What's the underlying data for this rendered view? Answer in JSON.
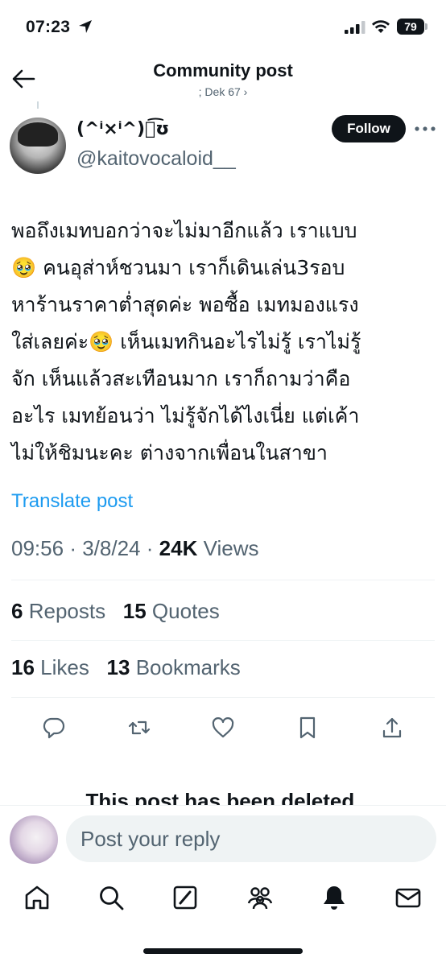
{
  "status_bar": {
    "time": "07:23",
    "battery": "79"
  },
  "header": {
    "title": "Community post",
    "subtitle": "; Dek 67 ›"
  },
  "author": {
    "display_name": "(^ⁱ×ⁱ^)ノ͡ʊ",
    "handle": "@kaitovocaloid__",
    "follow_label": "Follow"
  },
  "post": {
    "lines": [
      "พอถึงเมทบอกว่าจะไม่มาอีกแล้ว เราแบบ",
      "🥹 คนอุส่าห์ชวนมา เราก็เดินเล่น3รอบ",
      "หาร้านราคาต่ำสุดค่ะ พอซื้อ เมทมองแรง",
      "ใส่เลยค่ะ🥹 เห็นเมทกินอะไรไม่รู้ เราไม่รู้",
      "จัก เห็นแล้วสะเทือนมาก เราก็ถามว่าคือ",
      "อะไร เมทย้อนว่า ไม่รู้จักได้ไงเนี่ย แต่เค้า",
      "ไม่ให้ชิมนะคะ ต่างจากเพื่อนในสาขา"
    ],
    "translate_label": "Translate post",
    "time": "09:56",
    "date": "3/8/24",
    "views_count": "24K",
    "views_label": "Views",
    "separator": "·"
  },
  "stats": {
    "reposts_count": "6",
    "reposts_label": "Reposts",
    "quotes_count": "15",
    "quotes_label": "Quotes",
    "likes_count": "16",
    "likes_label": "Likes",
    "bookmarks_count": "13",
    "bookmarks_label": "Bookmarks"
  },
  "deleted_notice": "This post has been deleted.",
  "reply": {
    "placeholder": "Post your reply"
  },
  "icons": {
    "status": [
      "location-arrow-icon",
      "signal-icon",
      "wifi-icon",
      "battery-icon"
    ],
    "actions": [
      "reply-icon",
      "repost-icon",
      "like-icon",
      "bookmark-icon",
      "share-icon"
    ],
    "nav": [
      "home-icon",
      "search-icon",
      "grok-icon",
      "communities-icon",
      "notifications-icon",
      "messages-icon"
    ]
  },
  "colors": {
    "text": "#0f1419",
    "secondary": "#536471",
    "accent": "#1d9bf0",
    "divider": "#eff3f4"
  }
}
